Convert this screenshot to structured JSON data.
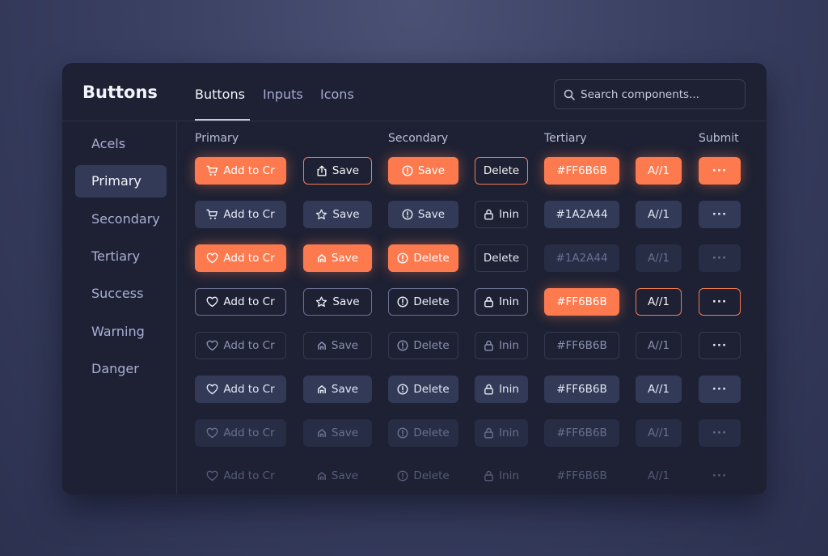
{
  "app_title": "Buttons",
  "tabs": [
    "Buttons",
    "Inputs",
    "Icons"
  ],
  "search": {
    "placeholder": "Search components..."
  },
  "sidebar": [
    "Acels",
    "Primary",
    "Secondary",
    "Tertiary",
    "Success",
    "Warning",
    "Danger"
  ],
  "columns": [
    "Primary",
    "Secondary",
    "Tertiary",
    "Submit"
  ],
  "rows": [
    [
      "Add to Cr",
      "Save",
      "Save",
      "Delete",
      "#FF6B6B",
      "A//1",
      "···"
    ],
    [
      "Add to Cr",
      "Save",
      "Save",
      "Inin",
      "#1A2A44",
      "A//1",
      "···"
    ],
    [
      "Add to Cr",
      "Save",
      "Delete",
      "Delete",
      "#1A2A44",
      "A//1",
      "···"
    ],
    [
      "Add to Cr",
      "Save",
      "Delete",
      "Inin",
      "#FF6B6B",
      "A//1",
      "···"
    ],
    [
      "Add to Cr",
      "Save",
      "Delete",
      "Inin",
      "#FF6B6B",
      "A//1",
      "···"
    ],
    [
      "Add to Cr",
      "Save",
      "Delete",
      "Inin",
      "#FF6B6B",
      "A//1",
      "···"
    ],
    [
      "Add to Cr",
      "Save",
      "Delete",
      "Inin",
      "#FF6B6B",
      "A//1",
      "···"
    ],
    [
      "Add to Cr",
      "Save",
      "Delete",
      "Inin",
      "#FF6B6B",
      "A//1",
      "···"
    ]
  ],
  "colors": {
    "accent": "#fd7a4f",
    "panel": "#1d2133",
    "page": "#3a4062"
  }
}
